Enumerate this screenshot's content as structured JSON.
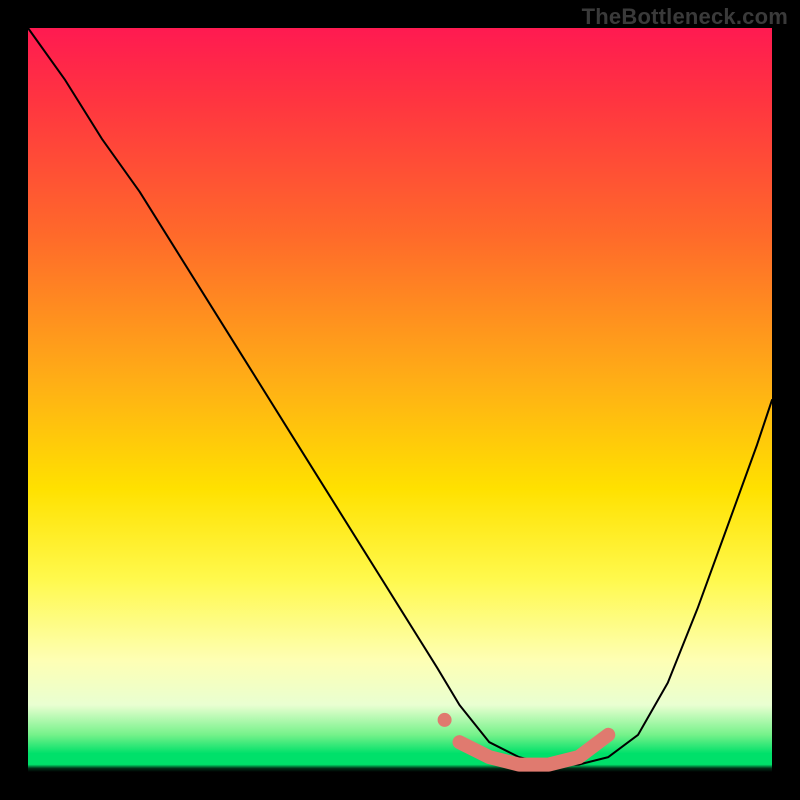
{
  "watermark": "TheBottleneck.com",
  "chart_data": {
    "type": "line",
    "title": "",
    "xlabel": "",
    "ylabel": "",
    "xlim": [
      0,
      100
    ],
    "ylim": [
      0,
      100
    ],
    "grid": false,
    "legend": false,
    "series": [
      {
        "name": "bottleneck-curve",
        "color": "#000000",
        "x": [
          0,
          5,
          10,
          15,
          20,
          25,
          30,
          35,
          40,
          45,
          50,
          55,
          58,
          62,
          66,
          70,
          74,
          78,
          82,
          86,
          90,
          94,
          98,
          100
        ],
        "y": [
          100,
          93,
          85,
          78,
          70,
          62,
          54,
          46,
          38,
          30,
          22,
          14,
          9,
          4,
          2,
          1,
          1,
          2,
          5,
          12,
          22,
          33,
          44,
          50
        ]
      },
      {
        "name": "optimal-region-marker",
        "color": "#e07a6f",
        "x": [
          58,
          62,
          66,
          70,
          74,
          78
        ],
        "y": [
          4,
          2,
          1,
          1,
          2,
          5
        ]
      }
    ],
    "background_gradient": {
      "stops": [
        {
          "pos": 0.0,
          "color": "#ff1a51"
        },
        {
          "pos": 0.28,
          "color": "#ff6a2a"
        },
        {
          "pos": 0.62,
          "color": "#ffe100"
        },
        {
          "pos": 0.85,
          "color": "#feffb4"
        },
        {
          "pos": 0.95,
          "color": "#75f28a"
        },
        {
          "pos": 0.98,
          "color": "#00e06a"
        },
        {
          "pos": 1.0,
          "color": "#000000"
        }
      ]
    },
    "annotations": [
      {
        "text": "TheBottleneck.com",
        "x": 100,
        "y": 100,
        "anchor": "top-right"
      }
    ]
  }
}
